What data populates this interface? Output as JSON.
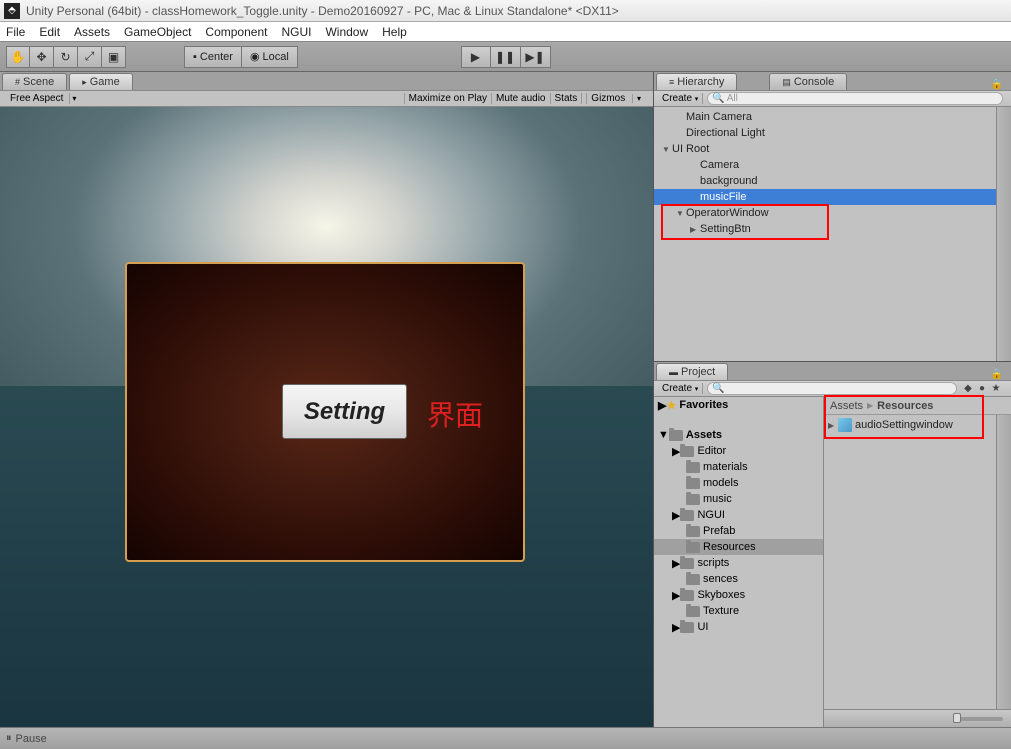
{
  "titlebar": {
    "text": "Unity Personal (64bit) - classHomework_Toggle.unity - Demo20160927 - PC, Mac & Linux Standalone* <DX11>"
  },
  "menubar": {
    "file": "File",
    "edit": "Edit",
    "assets": "Assets",
    "gameobject": "GameObject",
    "component": "Component",
    "ngui": "NGUI",
    "window": "Window",
    "help": "Help"
  },
  "toolbar": {
    "center": "Center",
    "local": "Local"
  },
  "left_tabs": {
    "scene": "Scene",
    "game": "Game"
  },
  "game_opts": {
    "aspect": "Free Aspect",
    "maximize": "Maximize on Play",
    "mute": "Mute audio",
    "stats": "Stats",
    "gizmos": "Gizmos"
  },
  "game_view": {
    "setting_label": "Setting",
    "annotation": "界面"
  },
  "hierarchy": {
    "tab": "Hierarchy",
    "console_tab": "Console",
    "create": "Create",
    "search_placeholder": "All",
    "items": {
      "main_camera": "Main Camera",
      "directional_light": "Directional Light",
      "ui_root": "UI Root",
      "camera": "Camera",
      "background": "background",
      "music_file": "musicFile",
      "operator_window": "OperatorWindow",
      "setting_btn": "SettingBtn"
    }
  },
  "project": {
    "tab": "Project",
    "create": "Create",
    "favorites": "Favorites",
    "assets": "Assets",
    "folders": {
      "editor": "Editor",
      "materials": "materials",
      "models": "models",
      "music": "music",
      "ngui": "NGUI",
      "prefab": "Prefab",
      "resources": "Resources",
      "scripts": "scripts",
      "sences": "sences",
      "skyboxes": "Skyboxes",
      "texture": "Texture",
      "ui": "UI"
    },
    "breadcrumb": {
      "assets": "Assets",
      "resources": "Resources"
    },
    "content": {
      "audio_setting_window": "audioSettingwindow"
    }
  },
  "statusbar": {
    "pause": "Pause"
  }
}
